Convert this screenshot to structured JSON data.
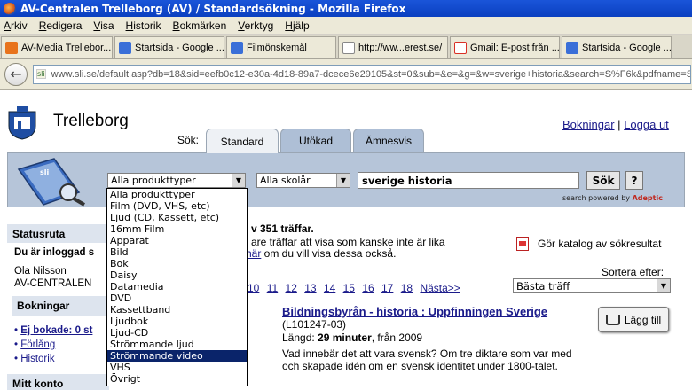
{
  "window": {
    "title": "AV-Centralen Trelleborg (AV) / Standardsökning - Mozilla Firefox"
  },
  "menu": [
    "Arkiv",
    "Redigera",
    "Visa",
    "Historik",
    "Bokmärken",
    "Verktyg",
    "Hjälp"
  ],
  "browser_tabs": [
    {
      "label": "AV-Media Trellebor...",
      "icon": "sli-orange-icon",
      "color": "#e8731c"
    },
    {
      "label": "Startsida - Google ...",
      "icon": "page-icon",
      "color": "#3a6fd8"
    },
    {
      "label": "Filmönskemål",
      "icon": "page-icon",
      "color": "#3a6fd8"
    },
    {
      "label": "http://ww...erest.se/",
      "icon": "blank-page-icon",
      "color": "#ffffff"
    },
    {
      "label": "Gmail: E-post från ...",
      "icon": "gmail-icon",
      "color": "#d93025"
    },
    {
      "label": "Startsida - Google ...",
      "icon": "page-icon",
      "color": "#3a6fd8"
    }
  ],
  "address": {
    "site_label": "sli",
    "url": "www.sli.se/default.asp?db=18&sid=eefb0c12-e30a-4d18-89a7-dcece6e29105&st=0&sub=&e=&g=&w=sverige+historia&search=S%F6k&pdfname=S%F6k"
  },
  "site": {
    "title": "Trelleborg",
    "links": {
      "bokningar": "Bokningar",
      "separator": "|",
      "logout": "Logga ut"
    },
    "sok_label": "Sök:",
    "search_tabs": [
      "Standard",
      "Utökad",
      "Ämnesvis"
    ]
  },
  "search": {
    "product_select": "Alla produkttyper",
    "school_select": "Alla skolår",
    "query": "sverige historia",
    "submit": "Sök",
    "help": "?",
    "powered_prefix": "search powered by",
    "powered_brand": "Adeptic"
  },
  "dropdown_options": [
    "Alla produkttyper",
    "Film (DVD, VHS, etc)",
    "Ljud (CD, Kassett, etc)",
    "16mm Film",
    "Apparat",
    "Bild",
    "Bok",
    "Daisy",
    "Datamedia",
    "DVD",
    "Kassettband",
    "Ljudbok",
    "Ljud-CD",
    "Strömmande ljud",
    "Strömmande video",
    "VHS",
    "Övrigt"
  ],
  "dropdown_highlighted_index": 14,
  "sidebar": {
    "status_title": "Statusruta",
    "login_text": "Du är inloggad s",
    "user_name": "Ola Nilsson",
    "org": "AV-CENTRALEN",
    "bookings_title": "Bokningar",
    "links": [
      "Ej bokade: 0 st",
      "Förlång",
      "Historik"
    ],
    "account_title": "Mitt konto"
  },
  "results": {
    "hits_text": "v 351 träffar.",
    "more_text_1": "are träffar att visa som kanske inte är lika",
    "more_link": "här",
    "more_text_2": " om du vill visa dessa också.",
    "catalog_text": "Gör katalog av sökresultat",
    "sort_label": "Sortera efter:",
    "sort_value": "Bästa träff",
    "pages": [
      "10",
      "11",
      "12",
      "13",
      "14",
      "15",
      "16",
      "17",
      "18",
      "Nästa>>"
    ],
    "add_button": "Lägg till",
    "item": {
      "title": "Bildningsbyrån - historia : Uppfinningen Sverige",
      "id": "(L101247-03)",
      "length_prefix": "Längd: ",
      "length_value": "29 minuter",
      "length_suffix": ", från 2009",
      "description": "Vad innebär det att vara svensk? Om tre diktare som var med och skapade idén om en svensk identitet under 1800-talet."
    }
  }
}
